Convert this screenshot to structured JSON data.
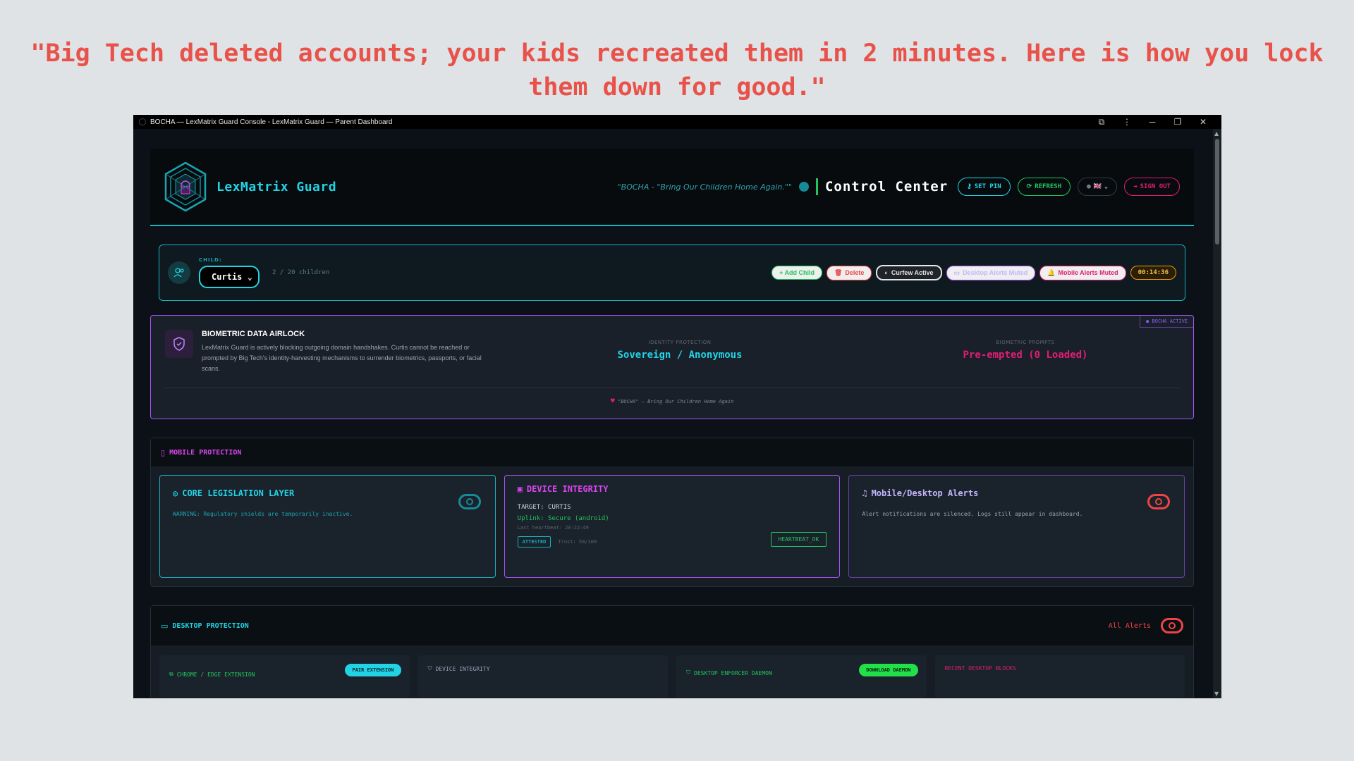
{
  "headline": "\"Big Tech deleted accounts; your kids recreated them in 2 minutes. Here is how you lock them down for good.\"",
  "window": {
    "title": "BOCHA — LexMatrix Guard Console - LexMatrix Guard — Parent Dashboard",
    "controls": {
      "extensions": "⧉",
      "menu": "⋮",
      "minimize": "─",
      "restore": "❐",
      "close": "✕"
    }
  },
  "header": {
    "brand": "LexMatrix Guard",
    "motto": "\"BOCHA - \"Bring Our Children Home Again.\"\"",
    "title": "Control Center",
    "set_pin": "SET PIN",
    "refresh": "REFRESH",
    "lang_flag": "🇬🇧",
    "sign_out": "SIGN OUT"
  },
  "child_bar": {
    "label": "CHILD:",
    "selected": "Curtis",
    "count": "2 / 20 children",
    "add": "+ Add Child",
    "delete": "Delete",
    "curfew": "Curfew Active",
    "desktop_muted": "Desktop Alerts Muted",
    "mobile_muted": "Mobile Alerts Muted",
    "timer": "00:14:36"
  },
  "airlock": {
    "badge": "BOCHA ACTIVE",
    "title": "BIOMETRIC DATA AIRLOCK",
    "description": "LexMatrix Guard is actively blocking outgoing domain handshakes. Curtis cannot be reached or prompted by Big Tech's identity-harvesting mechanisms to surrender biometrics, passports, or facial scans.",
    "identity_label": "IDENTITY PROTECTION",
    "identity_value": "Sovereign / Anonymous",
    "prompts_label": "BIOMETRIC PROMPTS",
    "prompts_value": "Pre-empted (0 Loaded)",
    "footer": "\"BOCHA\" — Bring Our Children Home Again"
  },
  "mobile": {
    "title": "MOBILE PROTECTION",
    "core": {
      "title": "CORE LEGISLATION LAYER",
      "warning": "WARNING: Regulatory shields are temporarily inactive."
    },
    "integrity": {
      "title": "DEVICE INTEGRITY",
      "target": "TARGET: CURTIS",
      "uplink": "Uplink: Secure (android)",
      "heartbeat": "Last heartbeat: 20:22:49",
      "status": "HEARTBEAT_OK",
      "attested": "ATTESTED",
      "trust": "Trust: 50/100"
    },
    "alerts": {
      "title": "Mobile/Desktop Alerts",
      "body": "Alert notifications are silenced. Logs still appear in dashboard."
    }
  },
  "desktop": {
    "title": "DESKTOP PROTECTION",
    "all_alerts": "All Alerts",
    "ext": {
      "title": "CHROME / EDGE EXTENSION",
      "button": "PAIR EXTENSION"
    },
    "integrity": {
      "title": "DEVICE INTEGRITY"
    },
    "daemon": {
      "title": "DESKTOP ENFORCER DAEMON",
      "button": "DOWNLOAD DAEMON"
    },
    "blocks": {
      "title": "RECENT DESKTOP BLOCKS"
    }
  },
  "colors": {
    "cyan": "#22d3e6",
    "magenta": "#e11d74",
    "purple": "#a855f7",
    "green": "#22c55e",
    "red": "#ef4444"
  }
}
